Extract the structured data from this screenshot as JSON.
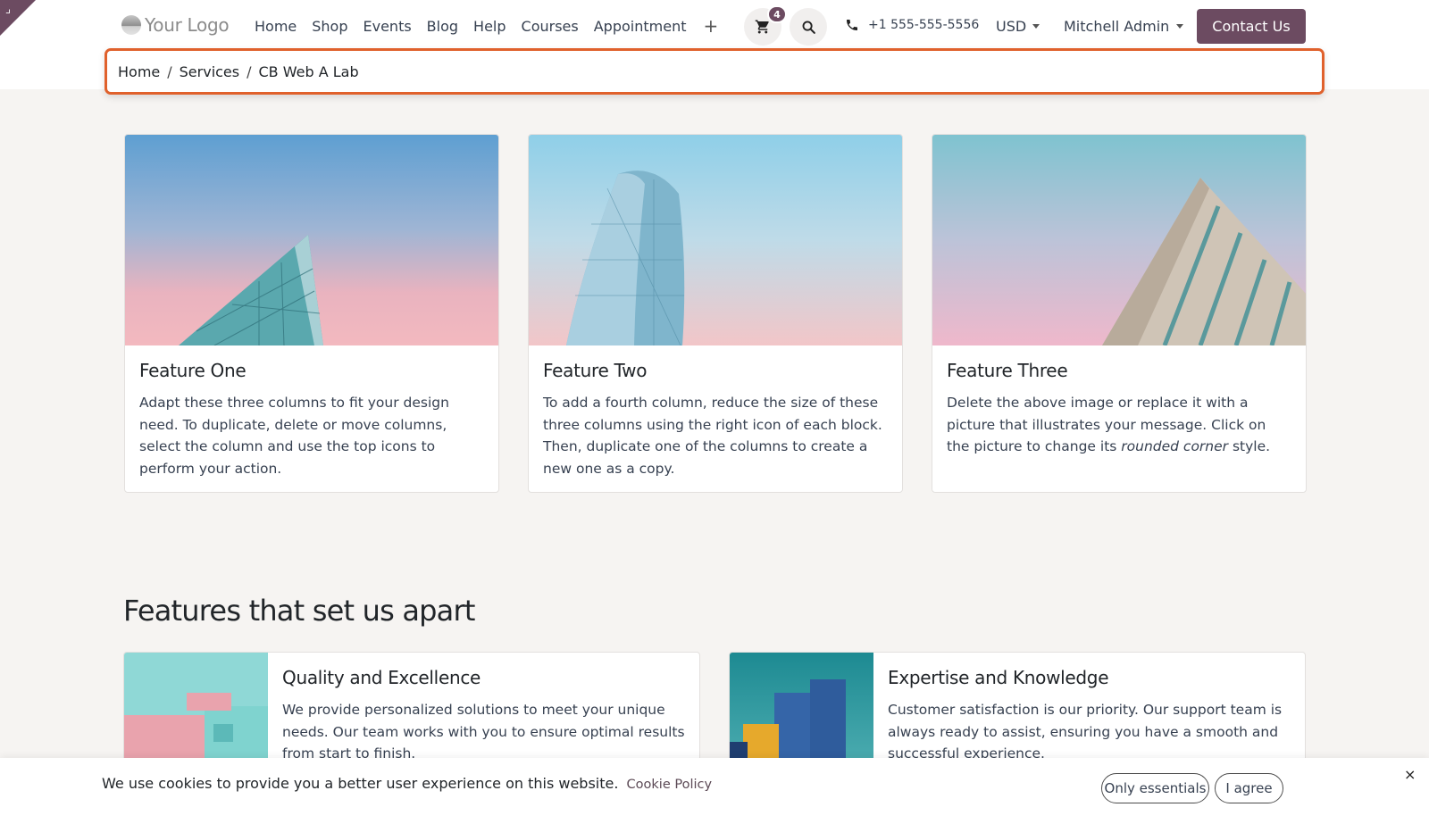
{
  "header": {
    "logo_text": "Your Logo",
    "nav": [
      "Home",
      "Shop",
      "Events",
      "Blog",
      "Help",
      "Courses",
      "Appointment"
    ],
    "plus_symbol": "+",
    "cart_count": "4",
    "phone": "+1 555-555-5556",
    "currency": "USD",
    "user": "Mitchell Admin",
    "contact_label": "Contact Us"
  },
  "breadcrumb": [
    "Home",
    "Services",
    "CB Web A Lab"
  ],
  "cards": [
    {
      "title": "Feature One",
      "text": "Adapt these three columns to fit your design need. To duplicate, delete or move columns, select the column and use the top icons to perform your action."
    },
    {
      "title": "Feature Two",
      "text": "To add a fourth column, reduce the size of these three columns using the right icon of each block. Then, duplicate one of the columns to create a new one as a copy."
    },
    {
      "title": "Feature Three",
      "text_before": "Delete the above image or replace it with a picture that illustrates your message. Click on the picture to change its ",
      "text_italic": "rounded corner",
      "text_after": " style."
    }
  ],
  "section_title": "Features that set us apart",
  "features": [
    {
      "title": "Quality and Excellence",
      "text": "We provide personalized solutions to meet your unique needs. Our team works with you to ensure optimal results from start to finish."
    },
    {
      "title": "Expertise and Knowledge",
      "text": "Customer satisfaction is our priority. Our support team is always ready to assist, ensuring you have a smooth and successful experience."
    }
  ],
  "cookie": {
    "text": "We use cookies to provide you a better user experience on this website.",
    "link": "Cookie Policy",
    "essentials": "Only essentials",
    "agree": "I agree",
    "close": "×"
  },
  "colors": {
    "brand": "#6c4b61",
    "highlight_border": "#e0612c"
  }
}
